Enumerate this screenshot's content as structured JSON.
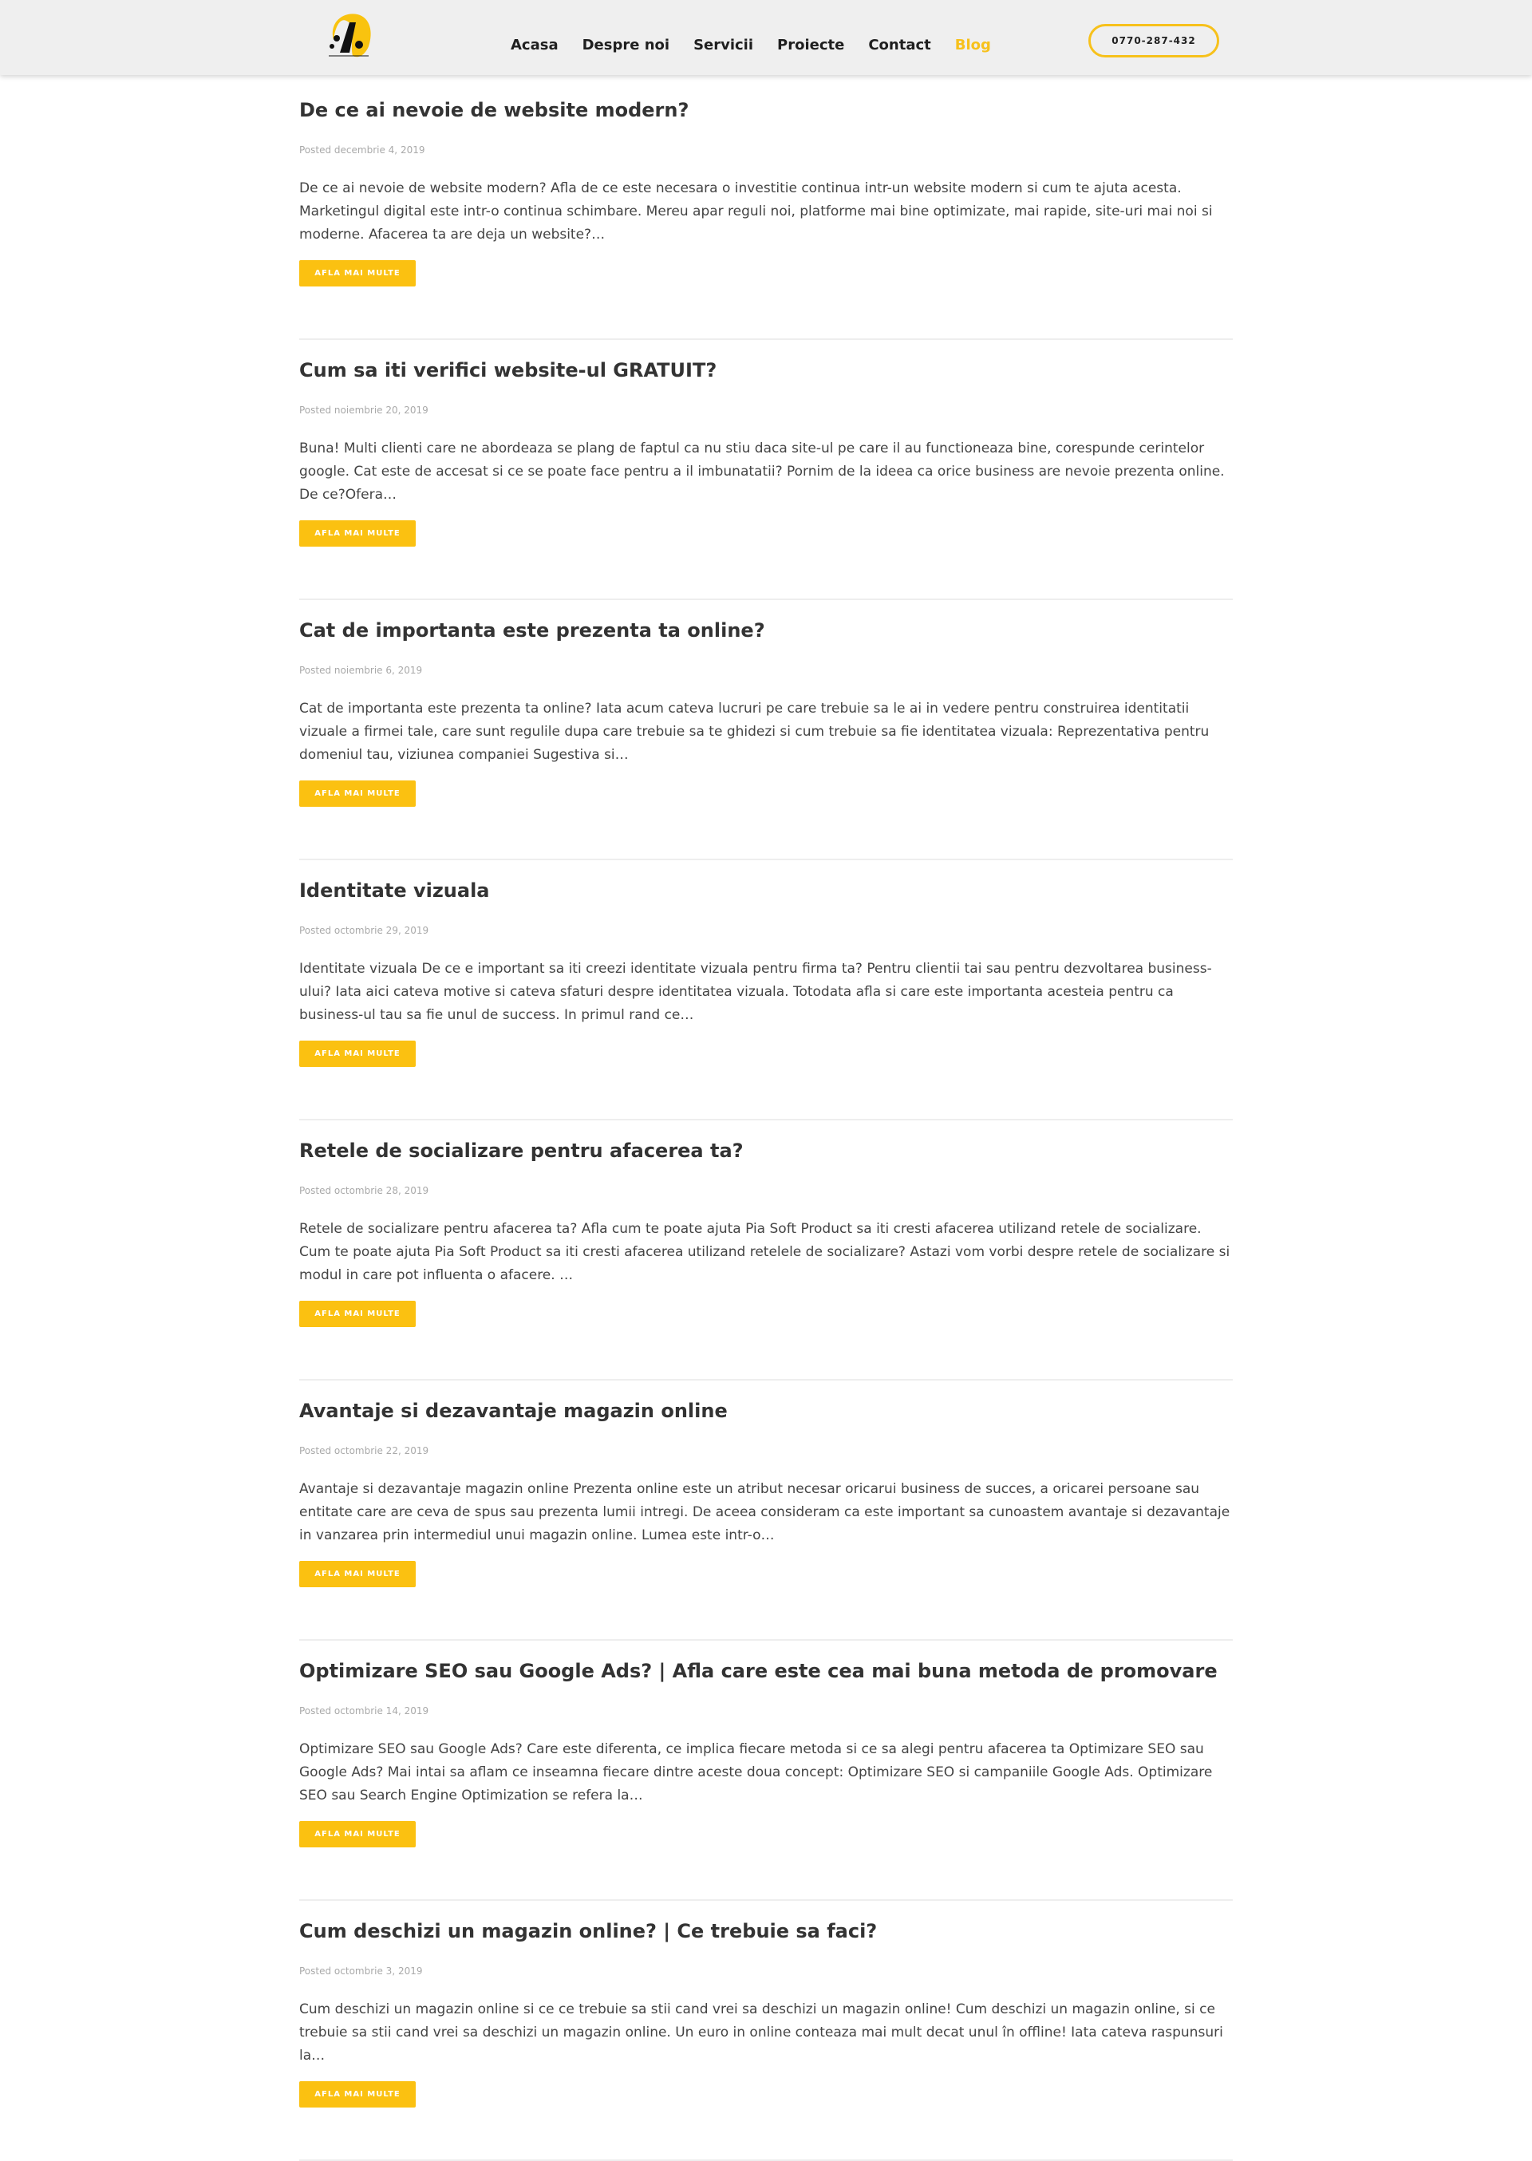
{
  "header": {
    "logo_label": "PIA SOFT",
    "nav": [
      {
        "label": "Acasa",
        "active": false
      },
      {
        "label": "Despre noi",
        "active": false
      },
      {
        "label": "Servicii",
        "active": false
      },
      {
        "label": "Proiecte",
        "active": false
      },
      {
        "label": "Contact",
        "active": false
      },
      {
        "label": "Blog",
        "active": true
      }
    ],
    "phone": "0770-287-432"
  },
  "colors": {
    "accent": "#f7c11b",
    "button": "#fbc111",
    "text": "#333333",
    "muted": "#a9a9a9"
  },
  "posts": [
    {
      "title": "De ce ai nevoie de website modern?",
      "date": "Posted decembrie 4, 2019",
      "excerpt": "De ce ai nevoie de website modern? Afla de ce este necesara o investitie continua intr-un website modern si cum te ajuta acesta. Marketingul digital este intr-o continua schimbare. Mereu apar reguli noi, platforme mai bine optimizate, mai rapide, site-uri mai noi si moderne. Afacerea ta are deja un website?…",
      "button": "AFLA MAI MULTE"
    },
    {
      "title": "Cum sa iti verifici website-ul GRATUIT?",
      "date": "Posted noiembrie 20, 2019",
      "excerpt": "Buna! Multi clienti care ne abordeaza se plang de faptul ca nu stiu daca site-ul pe care il au functioneaza bine, corespunde cerintelor google. Cat este de accesat si ce se poate face pentru a il imbunatatii? Pornim de la ideea ca orice business are nevoie prezenta online.  De ce?Ofera…",
      "button": "AFLA MAI MULTE"
    },
    {
      "title": "Cat de importanta este prezenta ta online?",
      "date": "Posted noiembrie 6, 2019",
      "excerpt": "Cat de importanta este prezenta ta online? Iata acum cateva lucruri pe care trebuie sa le ai in vedere pentru construirea identitatii vizuale a firmei tale, care sunt regulile dupa care trebuie sa te ghidezi si cum trebuie sa fie identitatea vizuala: Reprezentativa pentru domeniul tau, viziunea companiei Sugestiva si…",
      "button": "AFLA MAI MULTE"
    },
    {
      "title": "Identitate vizuala",
      "date": "Posted octombrie 29, 2019",
      "excerpt": "Identitate vizuala De ce e important sa iti creezi identitate vizuala pentru firma ta? Pentru clientii tai sau pentru dezvoltarea business-ului? Iata aici cateva motive si cateva sfaturi despre identitatea vizuala. Totodata afla si care este importanta acesteia pentru ca business-ul tau sa fie unul de success. In primul rand ce…",
      "button": "AFLA MAI MULTE"
    },
    {
      "title": "Retele de socializare pentru afacerea ta?",
      "date": "Posted octombrie 28, 2019",
      "excerpt": "Retele de socializare pentru afacerea ta? Afla cum te poate ajuta Pia Soft Product sa iti cresti afacerea utilizand retele de socializare.  Cum te poate ajuta Pia Soft Product sa iti cresti afacerea utilizand retelele de socializare? Astazi vom vorbi despre retele de socializare si modul in care pot influenta o afacere. …",
      "button": "AFLA MAI MULTE"
    },
    {
      "title": "Avantaje si dezavantaje magazin online",
      "date": "Posted octombrie 22, 2019",
      "excerpt": "Avantaje si dezavantaje magazin online Prezenta online este un atribut necesar oricarui business de succes, a oricarei persoane sau entitate care are ceva de spus sau prezenta lumii intregi. De aceea consideram ca este important sa cunoastem avantaje si dezavantaje in vanzarea prin intermediul unui magazin online. Lumea este intr-o…",
      "button": "AFLA MAI MULTE"
    },
    {
      "title": "Optimizare SEO sau Google Ads? | Afla care este cea mai buna metoda de promovare",
      "date": "Posted octombrie 14, 2019",
      "excerpt": "Optimizare SEO sau Google Ads? Care este diferenta, ce implica fiecare metoda si ce sa alegi pentru afacerea ta Optimizare SEO sau Google Ads? Mai intai sa aflam ce inseamna fiecare dintre aceste doua concept: Optimizare SEO si campaniile Google Ads. Optimizare SEO sau Search Engine Optimization se refera la…",
      "button": "AFLA MAI MULTE"
    },
    {
      "title": "Cum deschizi un magazin online? | Ce trebuie sa faci?",
      "date": "Posted octombrie 3, 2019",
      "excerpt": "Cum deschizi un magazin online si ce ce trebuie sa stii cand vrei sa deschizi un magazin online! Cum deschizi un magazin online, si ce trebuie sa stii cand vrei sa deschizi un magazin online. Un euro in online conteaza mai mult decat unul în offline! Iata cateva raspunsuri la…",
      "button": "AFLA MAI MULTE"
    }
  ]
}
